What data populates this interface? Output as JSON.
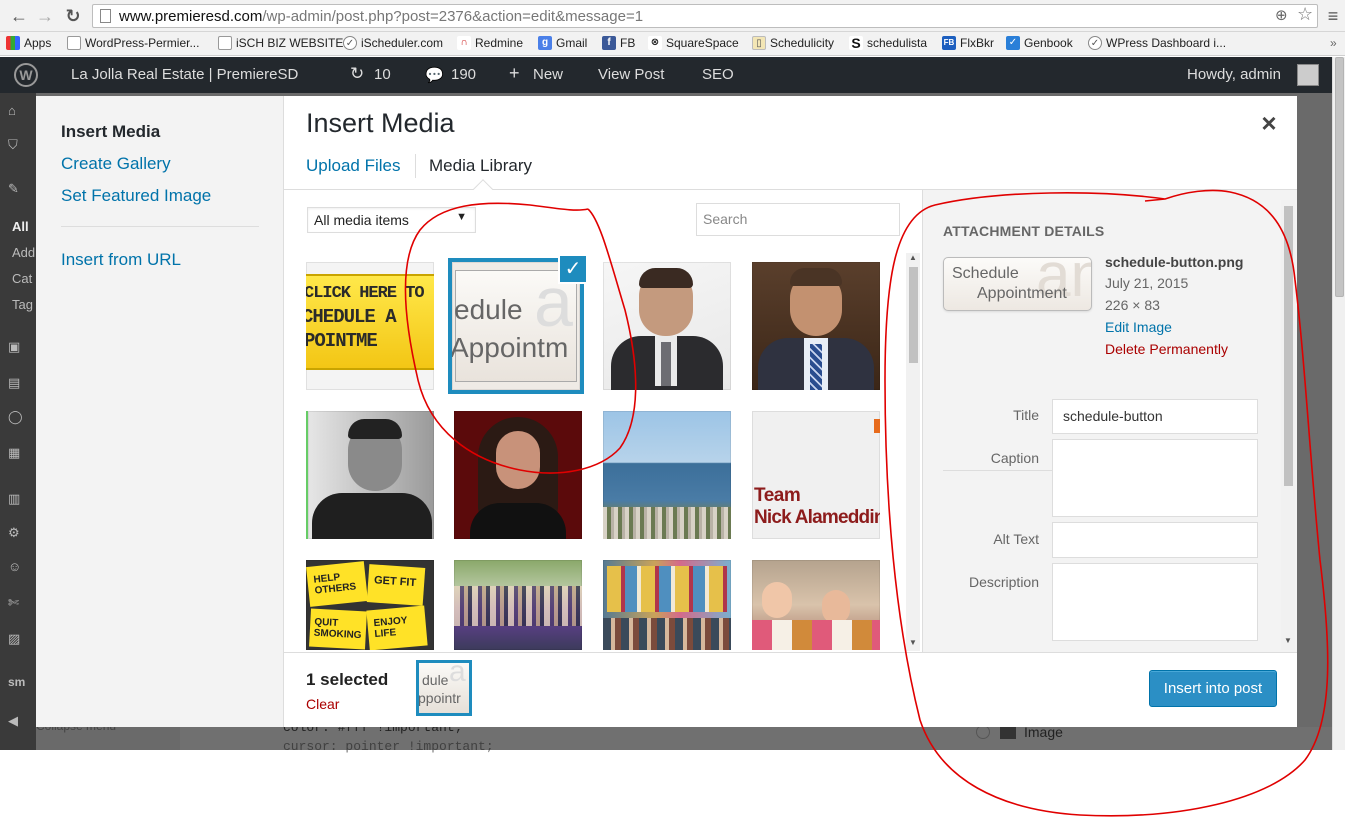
{
  "browser": {
    "url_host": "www.premieresd.com",
    "url_rest": "/wp-admin/post.php?post=2376&action=edit&message=1",
    "bookmarks": [
      {
        "label": "Apps",
        "icon": "apps-grid-icon"
      },
      {
        "label": "WordPress-Permier...",
        "icon": "page-icon"
      },
      {
        "label": "iSCH BIZ WEBSITE",
        "icon": "page-icon"
      },
      {
        "label": "iScheduler.com",
        "icon": "ischeduler-icon"
      },
      {
        "label": "Redmine",
        "icon": "redmine-icon"
      },
      {
        "label": "Gmail",
        "icon": "google-icon"
      },
      {
        "label": "FB",
        "icon": "facebook-icon"
      },
      {
        "label": "SquareSpace",
        "icon": "squarespace-icon"
      },
      {
        "label": "Schedulicity",
        "icon": "schedulicity-icon"
      },
      {
        "label": "schedulista",
        "icon": "schedulista-icon"
      },
      {
        "label": "FlxBkr",
        "icon": "flxbkr-icon"
      },
      {
        "label": "Genbook",
        "icon": "genbook-icon"
      },
      {
        "label": "WPress Dashboard i...",
        "icon": "wordpress-icon"
      }
    ]
  },
  "adminbar": {
    "site_name": "La Jolla Real Estate | PremiereSD",
    "updates": "10",
    "comments": "190",
    "new_label": "New",
    "view_post": "View Post",
    "seo": "SEO",
    "howdy": "Howdy, admin"
  },
  "modal": {
    "menu": {
      "insert_media": "Insert Media",
      "create_gallery": "Create Gallery",
      "set_featured": "Set Featured Image",
      "insert_from_url": "Insert from URL"
    },
    "title": "Insert Media",
    "tabs": {
      "upload": "Upload Files",
      "library": "Media Library"
    },
    "filter_selected": "All media items",
    "search_placeholder": "Search",
    "thumbnails": {
      "schedule_text_1": "edule",
      "schedule_text_2": "Appointm",
      "click_here_1": "CLICK HERE TO",
      "click_here_2": "CHEDULE A",
      "click_here_3": "POINTME",
      "team_1": "Team",
      "team_2": "Nick Alameddin",
      "sticky_1": "HELP OTHERS",
      "sticky_2": "GET FIT",
      "sticky_3": "QUIT SMOKING",
      "sticky_4": "ENJOY LIFE"
    },
    "details": {
      "heading": "ATTACHMENT DETAILS",
      "preview_line1": "Schedule",
      "preview_line2": "Appointment",
      "filename": "schedule-button.png",
      "date": "July 21, 2015",
      "dimensions": "226 × 83",
      "edit_image": "Edit Image",
      "delete": "Delete Permanently",
      "title_label": "Title",
      "title_value": "schedule-button",
      "caption_label": "Caption",
      "alt_label": "Alt Text",
      "description_label": "Description"
    },
    "toolbar": {
      "selected_count": "1 selected",
      "clear": "Clear",
      "mini_line1": "dule",
      "mini_line2": "ppointr",
      "insert_button": "Insert into post"
    }
  },
  "background": {
    "code_line1": "color: #fff !important;",
    "code_line2": "cursor: pointer !important;",
    "image_option": "Image",
    "collapse_menu": "Collapse menu",
    "side_text": [
      "All",
      "Add",
      "Cat",
      "Tag"
    ]
  },
  "colors": {
    "wp_blue": "#0073aa",
    "selection_blue": "#1e8cbe",
    "delete_red": "#a00",
    "annotation_red": "#e00000",
    "adminbar": "#23282d"
  }
}
